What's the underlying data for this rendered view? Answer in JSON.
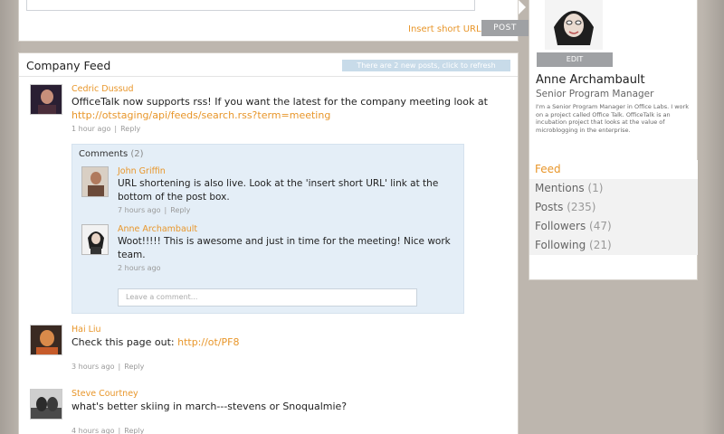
{
  "composer": {
    "short_url_label": "Insert short URL",
    "post_button": "POST"
  },
  "feed": {
    "title": "Company Feed",
    "refresh_notice": "There are 2 new posts, click to refresh",
    "posts": [
      {
        "author": "Cedric Dussud",
        "text": "OfficeTalk now supports rss! If you want the latest for the company meeting look at",
        "link": "http://otstaging/api/feeds/search.rss?term=meeting",
        "time": "1 hour ago",
        "reply": "Reply"
      },
      {
        "author": "Hai Liu",
        "text": "Check this page out:",
        "link": "http://ot/PF8",
        "time": "3 hours ago",
        "reply": "Reply"
      },
      {
        "author": "Steve Courtney",
        "text": "what's better skiing in march---stevens or Snoqualmie?",
        "time": "4 hours ago",
        "reply": "Reply"
      }
    ],
    "comments": {
      "label": "Comments",
      "count": "(2)",
      "items": [
        {
          "author": "John Griffin",
          "text": "URL shortening is also live. Look at the 'insert short URL' link at the bottom of the post box.",
          "time": "7 hours ago",
          "reply": "Reply"
        },
        {
          "author": "Anne Archambault",
          "text": "Woot!!!!! This is awesome and just in time for the meeting! Nice work team.",
          "time": "2 hours ago"
        }
      ],
      "input_placeholder": "Leave a comment..."
    }
  },
  "profile": {
    "edit_button": "EDIT",
    "name": "Anne Archambault",
    "title": "Senior Program Manager",
    "bio": "I'm a Senior Program Manager in Office Labs. I work on a project called Office Talk. OfficeTalk is an incubation project that looks at the value of microblogging in the enterprise.",
    "nav": [
      {
        "label": "Feed",
        "count": ""
      },
      {
        "label": "Mentions",
        "count": "(1)"
      },
      {
        "label": "Posts",
        "count": "(235)"
      },
      {
        "label": "Followers",
        "count": "(47)"
      },
      {
        "label": "Following",
        "count": "(21)"
      }
    ]
  },
  "colors": {
    "accent": "#e8962a",
    "comment_bg": "#e4eef7",
    "button_gray": "#9fa1a4"
  }
}
